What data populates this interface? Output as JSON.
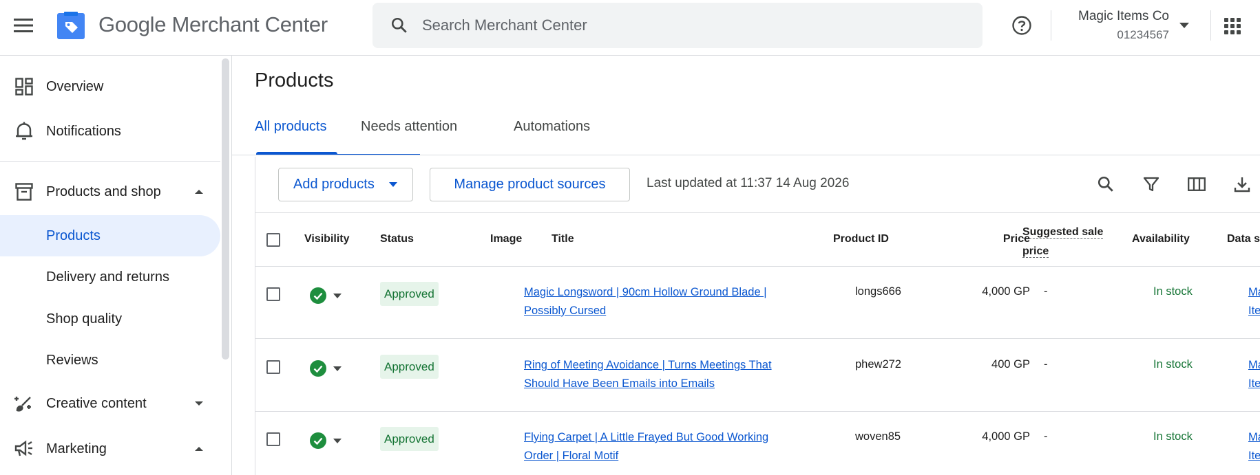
{
  "header": {
    "brand_google": "Google",
    "brand_product": "Merchant Center",
    "search_placeholder": "Search Merchant Center",
    "account_name": "Magic Items Co",
    "account_id": "01234567"
  },
  "sidebar": {
    "items": [
      {
        "label": "Overview",
        "icon": "dashboard-icon"
      },
      {
        "label": "Notifications",
        "icon": "bell-icon"
      },
      {
        "label": "Products and shop",
        "icon": "store-box-icon",
        "expanded": true
      },
      {
        "label": "Products",
        "active": true
      },
      {
        "label": "Delivery and returns"
      },
      {
        "label": "Shop quality"
      },
      {
        "label": "Reviews"
      },
      {
        "label": "Creative content",
        "icon": "brush-icon",
        "expanded": false
      },
      {
        "label": "Marketing",
        "icon": "megaphone-icon",
        "expanded": true
      }
    ]
  },
  "main": {
    "title": "Products",
    "tabs": [
      {
        "label": "All products",
        "active": true
      },
      {
        "label": "Needs attention"
      },
      {
        "label": "Automations"
      }
    ],
    "toolbar": {
      "add_products": "Add products",
      "manage_sources": "Manage product sources",
      "last_updated": "Last updated at 11:37 14 Aug 2026"
    },
    "table": {
      "columns": {
        "visibility": "Visibility",
        "status": "Status",
        "image": "Image",
        "title": "Title",
        "product_id": "Product ID",
        "price": "Price",
        "suggested_sale_price": "Suggested sale price",
        "availability": "Availability",
        "data_source": "Data s"
      },
      "rows": [
        {
          "status": "Approved",
          "title": "Magic Longsword | 90cm Hollow Ground Blade | Possibly Cursed",
          "product_id": "longs666",
          "price": "4,000 GP",
          "suggested_sale_price": "-",
          "availability": "In stock",
          "data_source": "Magic Items Co Feed"
        },
        {
          "status": "Approved",
          "title": "Ring of Meeting Avoidance | Turns Meetings That Should Have Been Emails into Emails",
          "product_id": "phew272",
          "price": "400 GP",
          "suggested_sale_price": "-",
          "availability": "In stock",
          "data_source": "Magic Items Co Feed"
        },
        {
          "status": "Approved",
          "title": "Flying Carpet | A Little Frayed But Good Working Order | Floral Motif",
          "product_id": "woven85",
          "price": "4,000 GP",
          "suggested_sale_price": "-",
          "availability": "In stock",
          "data_source": "Magic Items Co Feed"
        }
      ]
    }
  },
  "colors": {
    "accent": "#0b57d0",
    "active_nav_bg": "#e8f0fe",
    "approved_bg": "#e6f4ea",
    "approved_text": "#137333",
    "status_check": "#1e8e3e"
  }
}
